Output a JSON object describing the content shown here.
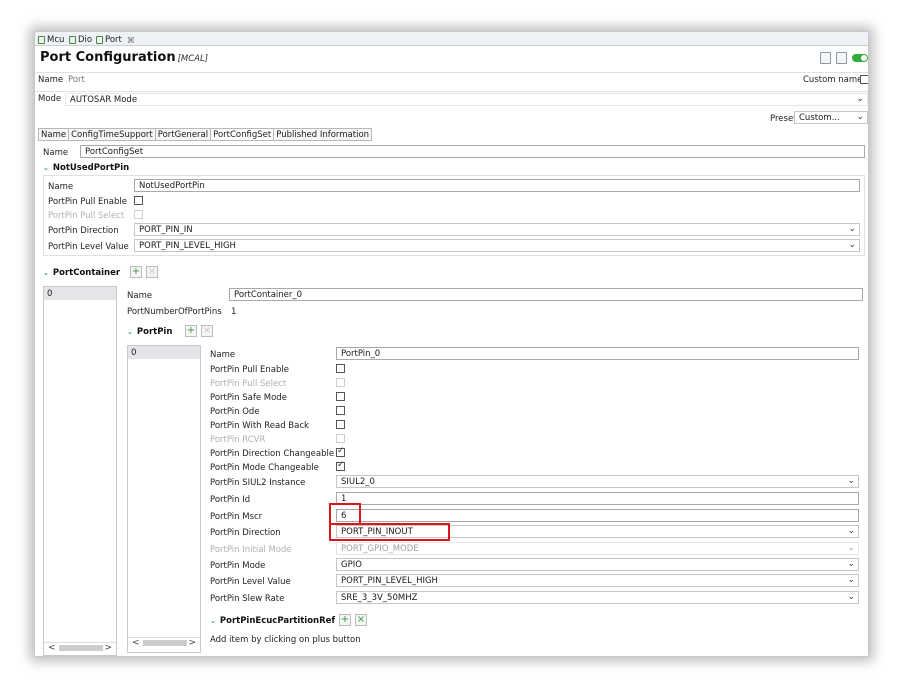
{
  "editor_tabs": [
    {
      "label": "Mcu"
    },
    {
      "label": "Dio"
    },
    {
      "label": "Port",
      "close": "⌘"
    }
  ],
  "header": {
    "title": "Port Configuration",
    "subtitle": "[MCAL]"
  },
  "name_row": {
    "label": "Name",
    "value": "Port",
    "custom_name_label": "Custom name"
  },
  "mode_row": {
    "label": "Mode",
    "value": "AUTOSAR Mode"
  },
  "preset": {
    "label": "Preset",
    "value": "Custom..."
  },
  "sub_tabs": [
    "Name",
    "ConfigTimeSupport",
    "PortGeneral",
    "PortConfigSet",
    "Published Information"
  ],
  "config_set": {
    "name_label": "Name",
    "name_value": "PortConfigSet"
  },
  "not_used": {
    "title": "NotUsedPortPin",
    "name_label": "Name",
    "name_value": "NotUsedPortPin",
    "pull_enable_label": "PortPin Pull Enable",
    "pull_select_label": "PortPin Pull Select",
    "direction_label": "PortPin Direction",
    "direction_value": "PORT_PIN_IN",
    "level_label": "PortPin Level Value",
    "level_value": "PORT_PIN_LEVEL_HIGH"
  },
  "container": {
    "title": "PortContainer",
    "list_item": "0",
    "name_label": "Name",
    "name_value": "PortContainer_0",
    "num_label": "PortNumberOfPortPins",
    "num_value": "1"
  },
  "portpin": {
    "title": "PortPin",
    "list_item": "0",
    "fields": {
      "name_label": "Name",
      "name_value": "PortPin_0",
      "pull_enable": "PortPin Pull Enable",
      "pull_select": "PortPin Pull Select",
      "safe_mode": "PortPin Safe Mode",
      "ode": "PortPin Ode",
      "read_back": "PortPin With Read Back",
      "rcvr": "PortPin RCVR",
      "dir_changeable": "PortPin Direction Changeable",
      "mode_changeable": "PortPin Mode Changeable",
      "siul2_label": "PortPin SIUL2 Instance",
      "siul2_value": "SIUL2_0",
      "id_label": "PortPin Id",
      "id_value": "1",
      "mscr_label": "PortPin Mscr",
      "mscr_value": "6",
      "direction_label": "PortPin Direction",
      "direction_value": "PORT_PIN_INOUT",
      "initial_mode_label": "PortPin Initial Mode",
      "initial_mode_value": "PORT_GPIO_MODE",
      "mode_label": "PortPin Mode",
      "mode_value": "GPIO",
      "level_label": "PortPin Level Value",
      "level_value": "PORT_PIN_LEVEL_HIGH",
      "slew_label": "PortPin Slew Rate",
      "slew_value": "SRE_3_3V_50MHZ"
    }
  },
  "ecuc": {
    "title": "PortPinEcucPartitionRef",
    "hint": "Add item by clicking on plus button"
  },
  "glyphs": {
    "add": "+",
    "del": "×",
    "left": "<",
    "right": ">",
    "chev": "⌄",
    "caret": "⌄"
  }
}
